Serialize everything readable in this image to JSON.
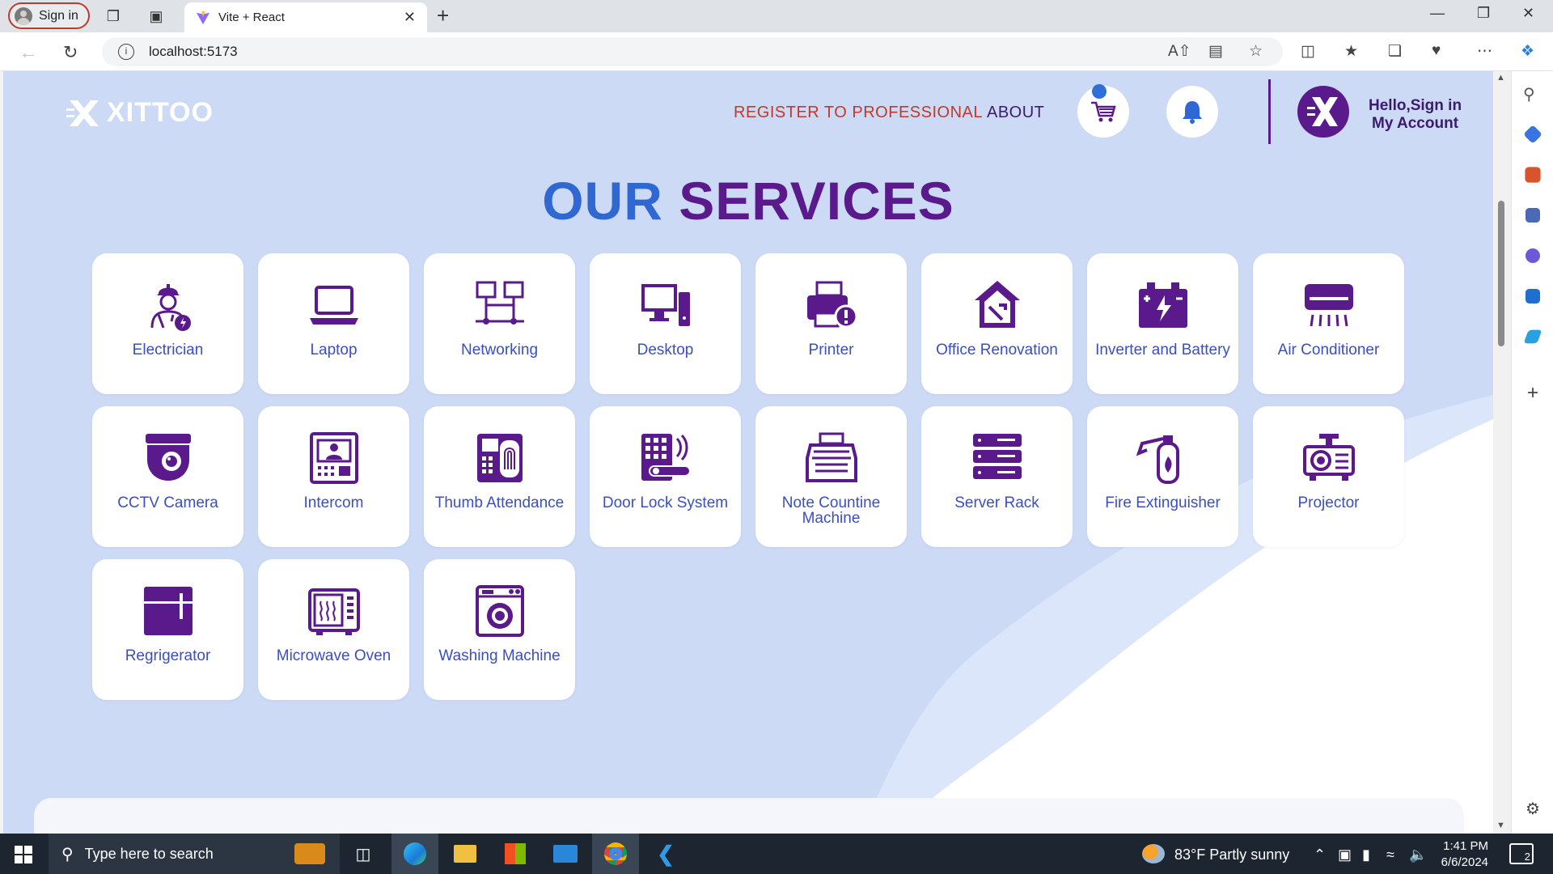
{
  "browser": {
    "signin_label": "Sign in",
    "tab_title": "Vite + React",
    "url": "localhost:5173"
  },
  "site": {
    "logo_text": "XITTOO",
    "nav": {
      "register": "REGISTER TO PROFESSIONAL",
      "about": "ABOUT"
    },
    "account": {
      "line1": "Hello,Sign in",
      "line2": "My Account"
    },
    "title_part1": "OUR",
    "title_part2": "SERVICES",
    "colors": {
      "title_blue": "#2f67d3",
      "title_purple": "#5a1a8c",
      "icon_purple": "#5a1a8c",
      "label_blue": "#3a4fc0",
      "register_red": "#c0392b",
      "background": "#ccdaf5"
    }
  },
  "services": [
    {
      "label": "Electrician",
      "icon": "electrician-icon"
    },
    {
      "label": "Laptop",
      "icon": "laptop-icon"
    },
    {
      "label": "Networking",
      "icon": "networking-icon"
    },
    {
      "label": "Desktop",
      "icon": "desktop-icon"
    },
    {
      "label": "Printer",
      "icon": "printer-icon"
    },
    {
      "label": "Office Renovation",
      "icon": "office-renovation-icon"
    },
    {
      "label": "Inverter and Battery",
      "icon": "battery-icon"
    },
    {
      "label": "Air Conditioner",
      "icon": "air-conditioner-icon"
    },
    {
      "label": "CCTV Camera",
      "icon": "cctv-camera-icon"
    },
    {
      "label": "Intercom",
      "icon": "intercom-icon"
    },
    {
      "label": "Thumb Attendance",
      "icon": "fingerprint-icon"
    },
    {
      "label": "Door Lock System",
      "icon": "door-lock-icon"
    },
    {
      "label": "Note Countine Machine",
      "icon": "note-counting-machine-icon"
    },
    {
      "label": "Server Rack",
      "icon": "server-rack-icon"
    },
    {
      "label": "Fire Extinguisher",
      "icon": "fire-extinguisher-icon"
    },
    {
      "label": "Projector",
      "icon": "projector-icon"
    },
    {
      "label": "Regrigerator",
      "icon": "refrigerator-icon"
    },
    {
      "label": "Microwave Oven",
      "icon": "microwave-icon"
    },
    {
      "label": "Washing Machine",
      "icon": "washing-machine-icon"
    }
  ],
  "taskbar": {
    "search_placeholder": "Type here to search",
    "weather": "83°F  Partly sunny",
    "time": "1:41 PM",
    "date": "6/6/2024",
    "notifications": "2"
  }
}
